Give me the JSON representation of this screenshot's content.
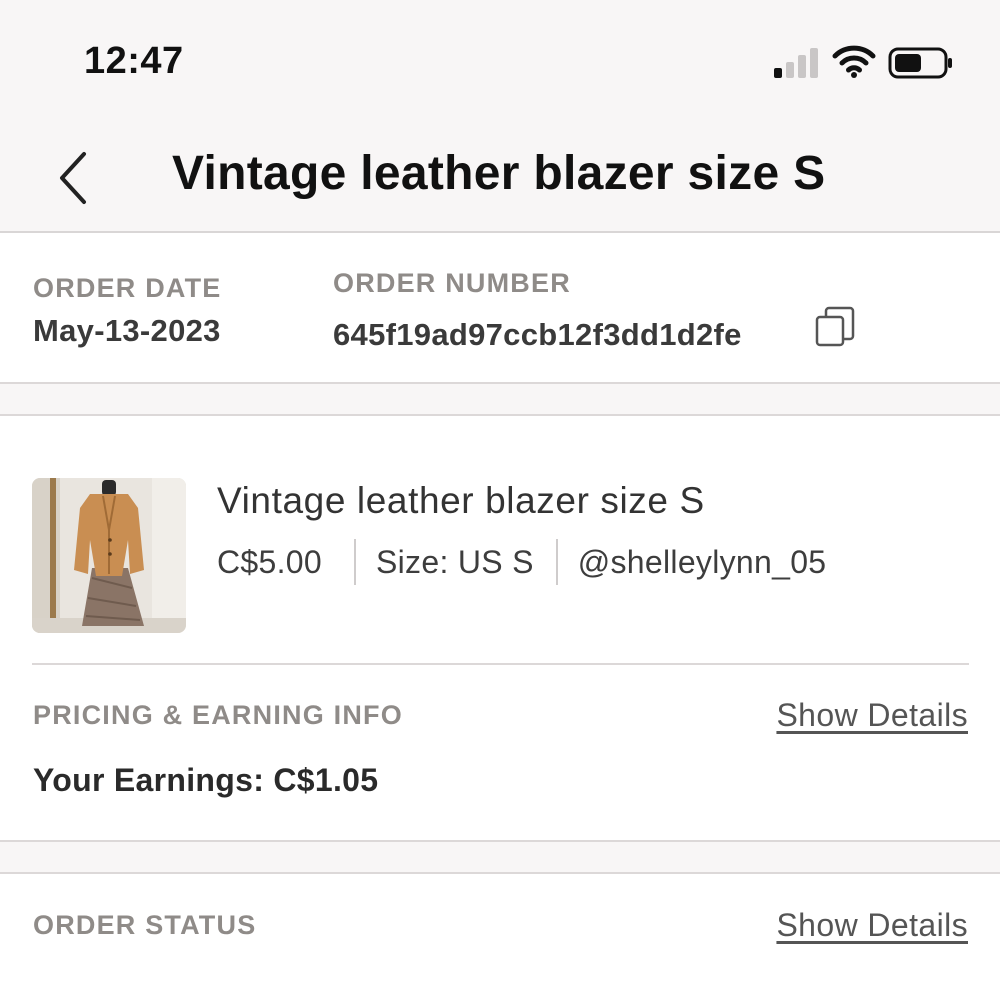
{
  "status_bar": {
    "time": "12:47",
    "icons": [
      "signal-icon",
      "wifi-icon",
      "battery-icon"
    ]
  },
  "header": {
    "back_icon": "chevron-left-icon",
    "title": "Vintage leather blazer size S"
  },
  "order_meta": {
    "order_date_label": "ORDER DATE",
    "order_date": "May-13-2023",
    "order_number_label": "ORDER NUMBER",
    "order_number": "645f19ad97ccb12f3dd1d2fe",
    "copy_icon": "copy-icon"
  },
  "item": {
    "title": "Vintage leather blazer size S",
    "price": "C$5.00",
    "size": "Size: US S",
    "seller": "@shelleylynn_05",
    "thumbnail": "photo of tan leather blazer on dress form"
  },
  "pricing": {
    "label": "PRICING & EARNING INFO",
    "show_details": "Show Details",
    "earnings": "Your Earnings: C$1.05"
  },
  "order_status": {
    "label": "ORDER STATUS",
    "show_details": "Show Details"
  },
  "colors": {
    "header_bg": "#f8f6f6",
    "label_gray": "#8f8b88",
    "divider": "#dcd8d8"
  }
}
